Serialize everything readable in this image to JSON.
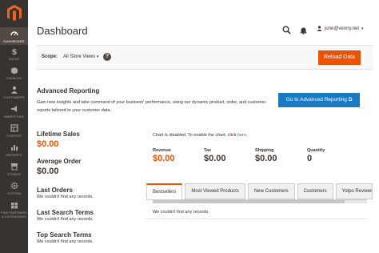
{
  "sidebar": {
    "items": [
      {
        "label": "Dashboard",
        "icon": "dashboard-icon"
      },
      {
        "label": "Sales",
        "icon": "dollar-icon"
      },
      {
        "label": "Catalog",
        "icon": "box-icon"
      },
      {
        "label": "Customers",
        "icon": "person-icon"
      },
      {
        "label": "Marketing",
        "icon": "megaphone-icon"
      },
      {
        "label": "Content",
        "icon": "layout-icon"
      },
      {
        "label": "Reports",
        "icon": "bar-chart-icon"
      },
      {
        "label": "Stores",
        "icon": "store-icon"
      },
      {
        "label": "System",
        "icon": "gear-icon"
      },
      {
        "label": "Find Partners & Extensions",
        "icon": "puzzle-icon"
      }
    ]
  },
  "header": {
    "title": "Dashboard",
    "user": "june@venny.net"
  },
  "scope": {
    "label": "Scope:",
    "value": "All Store Views",
    "help": "?",
    "reload_label": "Reload Data"
  },
  "advanced": {
    "title": "Advanced Reporting",
    "text": "Gain new insights and take command of your business' performance, using our dynamic product, order, and customer reports tailored to your customer data.",
    "button": "Go to Advanced Reporting"
  },
  "stats": {
    "lifetime_label": "Lifetime Sales",
    "lifetime_value": "$0.00",
    "avg_label": "Average Order",
    "avg_value": "$0.00",
    "last_orders_label": "Last Orders",
    "last_orders_empty": "We couldn't find any records.",
    "last_search_label": "Last Search Terms",
    "last_search_empty": "We couldn't find any records.",
    "top_search_label": "Top Search Terms",
    "top_search_empty": "We couldn't find any records."
  },
  "chart": {
    "message": "Chart is disabled. To enable the chart, click",
    "link": "here",
    "tail": "."
  },
  "totals": {
    "revenue_label": "Revenue",
    "revenue_value": "$0.00",
    "tax_label": "Tax",
    "tax_value": "$0.00",
    "shipping_label": "Shipping",
    "shipping_value": "$0.00",
    "quantity_label": "Quantity",
    "quantity_value": "0"
  },
  "tabs": {
    "items": [
      "Bestsellers",
      "Most Viewed Products",
      "New Customers",
      "Customers",
      "Yotpo Reviews"
    ],
    "content": "We couldn't find any records."
  },
  "colors": {
    "sidebar": "#373330",
    "accent_orange": "#eb5202",
    "accent_blue": "#1979c3"
  }
}
